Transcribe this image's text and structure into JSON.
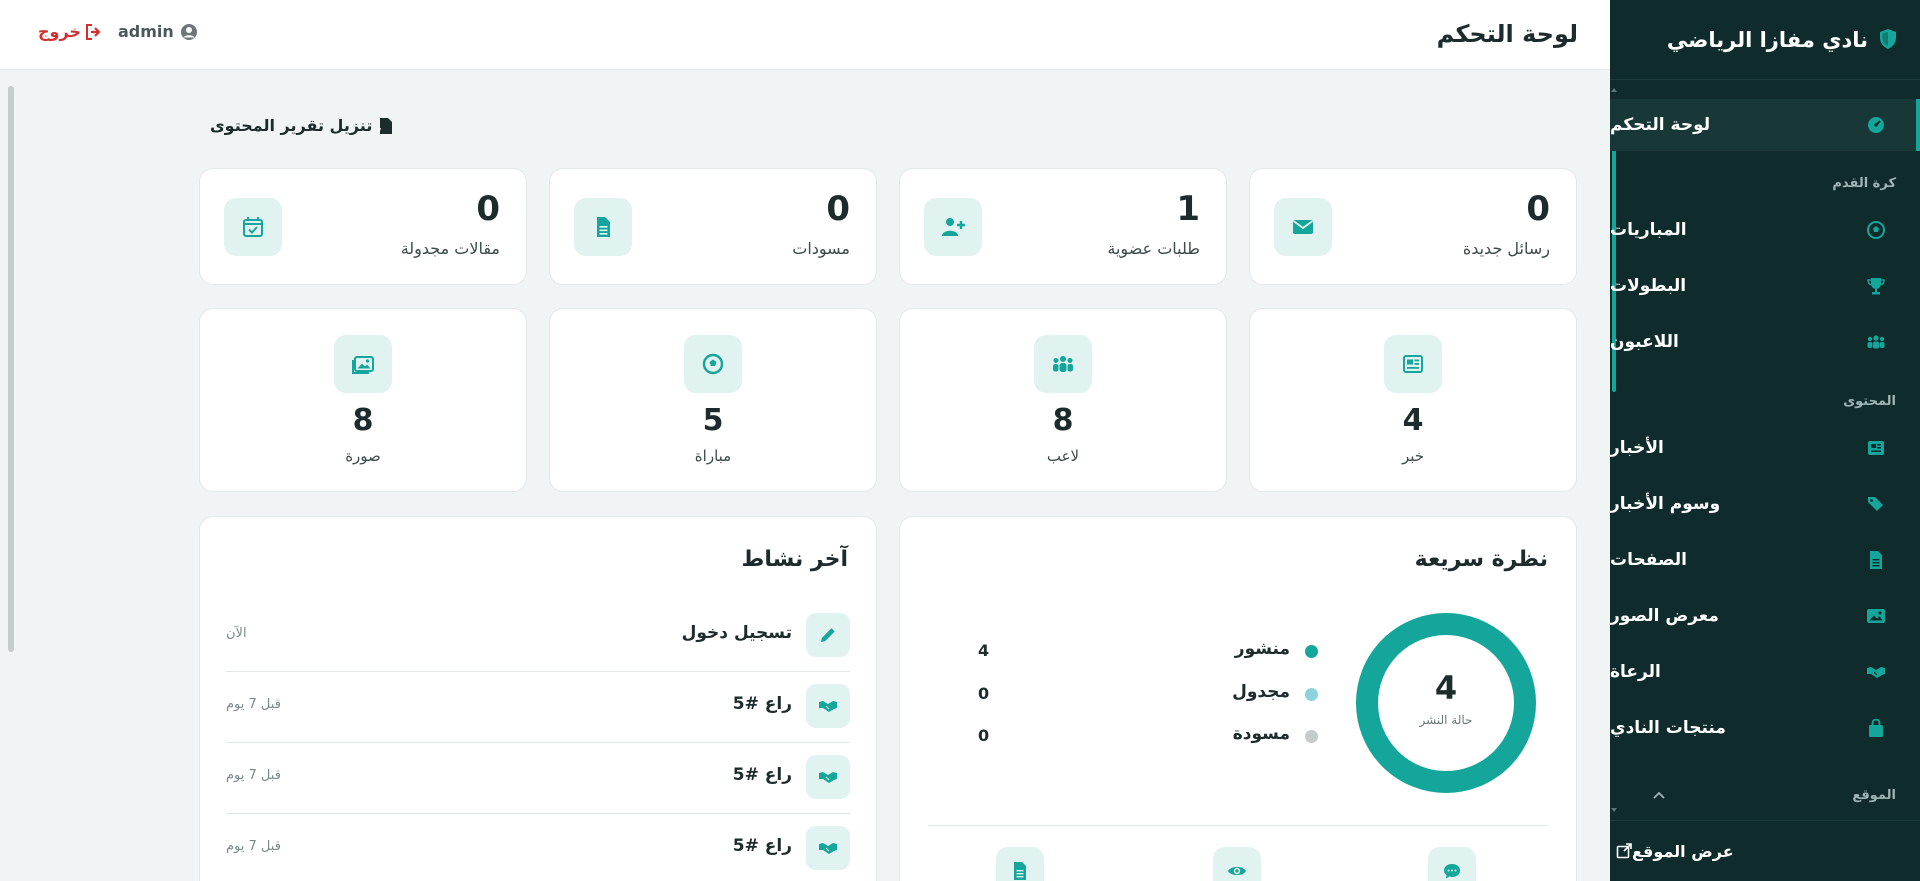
{
  "colors": {
    "accent": "#14a69a",
    "sidebar_bg": "#0f2b2b",
    "danger": "#d32f2f",
    "scheduled_dot": "#8dd3dc",
    "draft_dot": "#c5cbcb"
  },
  "sidebar": {
    "title": "نادي مفازا الرياضي",
    "logo_icon": "shield-icon",
    "dashboard": "لوحة التحكم",
    "section_football": "كرة القدم",
    "matches": "المباريات",
    "tournaments": "البطولات",
    "players": "اللاعبون",
    "section_content": "المحتوى",
    "news": "الأخبار",
    "news_tags": "وسوم الأخبار",
    "pages": "الصفحات",
    "gallery": "معرض الصور",
    "sponsors": "الرعاة",
    "products": "منتجات النادي",
    "section_site": "الموقع",
    "view_site": "عرض الموقع"
  },
  "topbar": {
    "title": "لوحة التحكم",
    "user": "admin",
    "logout": "خروج"
  },
  "main": {
    "download_report": "تنزيل تقرير المحتوى",
    "stats_top": [
      {
        "value": "0",
        "label": "رسائل جديدة",
        "icon": "envelope-icon"
      },
      {
        "value": "1",
        "label": "طلبات عضوية",
        "icon": "user-plus-icon"
      },
      {
        "value": "0",
        "label": "مسودات",
        "icon": "file-icon"
      },
      {
        "value": "0",
        "label": "مقالات مجدولة",
        "icon": "calendar-check-icon"
      }
    ],
    "stats_bottom": [
      {
        "value": "4",
        "label": "خبر",
        "icon": "newspaper-icon"
      },
      {
        "value": "8",
        "label": "لاعب",
        "icon": "people-icon"
      },
      {
        "value": "5",
        "label": "مباراة",
        "icon": "football-icon"
      },
      {
        "value": "8",
        "label": "صورة",
        "icon": "images-icon"
      }
    ],
    "overview": {
      "title": "نظرة سريعة",
      "donut_value": "4",
      "donut_caption": "حالة النشر",
      "published_fraction": 1.0,
      "legend": [
        {
          "label": "منشور",
          "value": "4"
        },
        {
          "label": "مجدول",
          "value": "0"
        },
        {
          "label": "مسودة",
          "value": "0"
        }
      ]
    },
    "activity": {
      "title": "آخر نشاط",
      "items": [
        {
          "text": "تسجيل دخول",
          "time": "الآن",
          "icon": "pencil-icon"
        },
        {
          "text": "راع #5",
          "time": "قبل 7 يوم",
          "icon": "handshake-icon"
        },
        {
          "text": "راع #5",
          "time": "قبل 7 يوم",
          "icon": "handshake-icon"
        },
        {
          "text": "راع #5",
          "time": "قبل 7 يوم",
          "icon": "handshake-icon"
        }
      ]
    }
  }
}
